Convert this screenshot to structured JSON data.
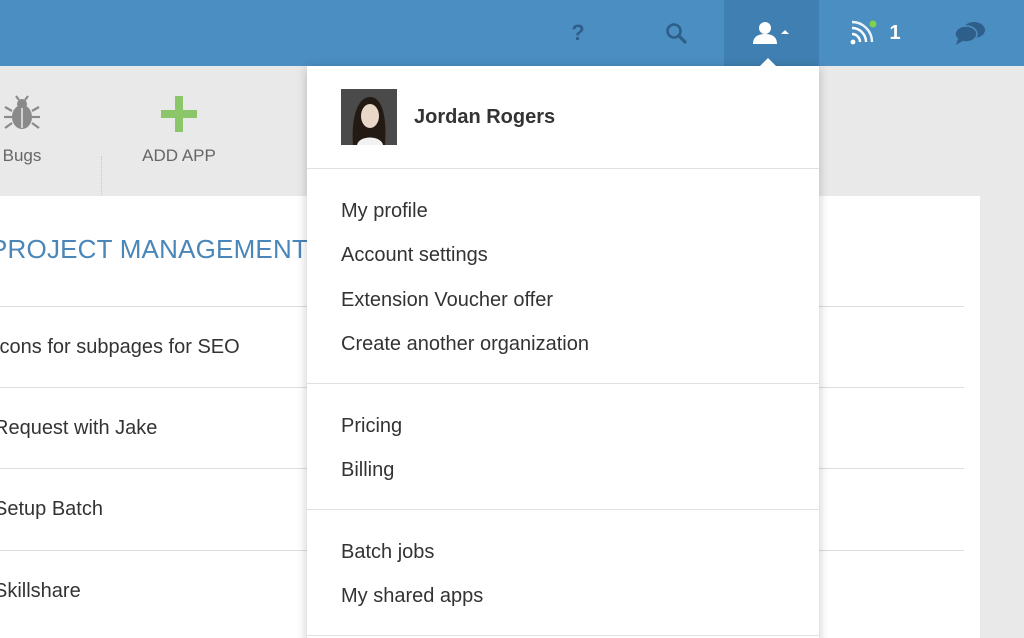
{
  "topbar": {
    "help_label": "?",
    "notification_count": "1",
    "icons": [
      "help-icon",
      "search-icon",
      "user-icon",
      "rss-icon",
      "chat-icon"
    ],
    "colors": {
      "bar": "#4b8ec2",
      "active": "#3f7fb1",
      "status_dot": "#7fd34a"
    }
  },
  "apps": [
    {
      "label": "Bugs",
      "icon": "bug-icon"
    },
    {
      "label": "ADD APP",
      "icon": "plus-icon"
    }
  ],
  "main": {
    "section_title": "PROJECT MANAGEMENT",
    "tasks": [
      "Icons for subpages for SEO",
      "Request with Jake",
      "Setup Batch",
      "Skillshare"
    ]
  },
  "dropdown": {
    "user_name": "Jordan Rogers",
    "sections": [
      [
        "My profile",
        "Account settings",
        "Extension Voucher offer",
        "Create another organization"
      ],
      [
        "Pricing",
        "Billing"
      ],
      [
        "Batch jobs",
        "My shared apps"
      ]
    ]
  }
}
